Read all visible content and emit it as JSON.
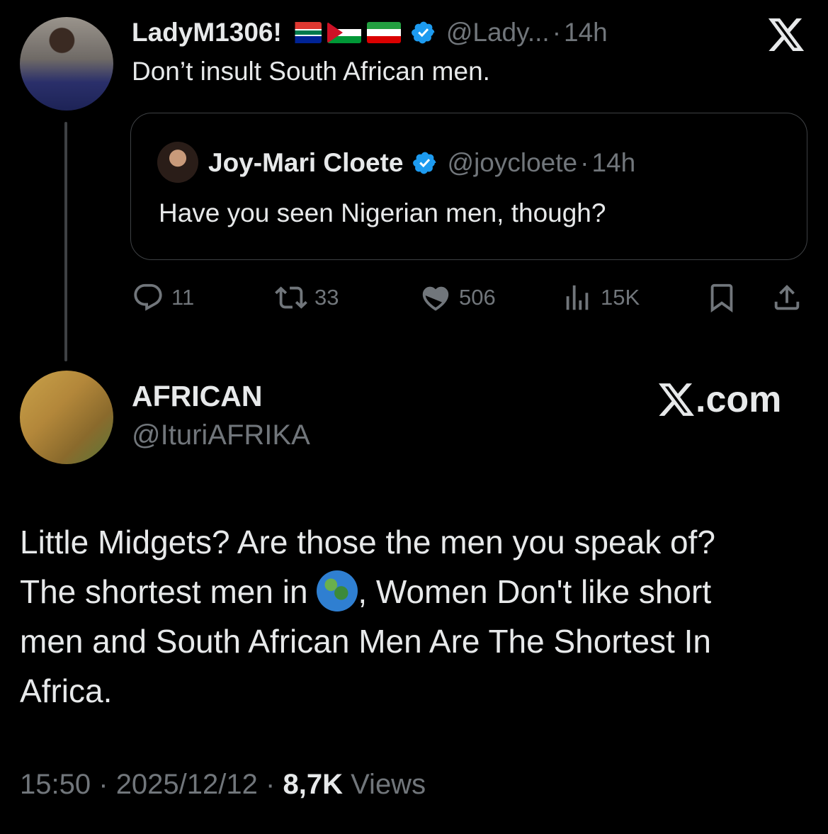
{
  "tweet1": {
    "display_name": "LadyM1306!",
    "flags": [
      "flag-south-africa-icon",
      "flag-palestine-icon",
      "flag-iran-icon"
    ],
    "handle": "@Lady...",
    "separator": "·",
    "time": "14h",
    "text": "Don’t insult South African men."
  },
  "quote": {
    "display_name": "Joy-Mari Cloete",
    "handle": "@joycloete",
    "separator": "·",
    "time": "14h",
    "text": "Have you seen Nigerian men, though?"
  },
  "actions": {
    "replies": "11",
    "retweets": "33",
    "likes": "506",
    "views": "15K"
  },
  "tweet2": {
    "display_name": "AFRICAN",
    "handle": "@IturiAFRIKA",
    "watermark": ".com",
    "body_line1": "Little Midgets? Are those the men you speak of?",
    "body_line2a": "The shortest men in ",
    "body_line2b": ",  Women Don't like short",
    "body_line3": "men and South African Men Are The Shortest In",
    "body_line4": "Africa.",
    "time": "15:50",
    "date": "2025/12/12",
    "views_count": "8,7K",
    "views_label": "Views",
    "dot": "·"
  },
  "colors": {
    "background": "#000000",
    "text": "#e7e9ea",
    "muted": "#71767b",
    "verified": "#1d9bf0",
    "border": "#3e4144"
  }
}
